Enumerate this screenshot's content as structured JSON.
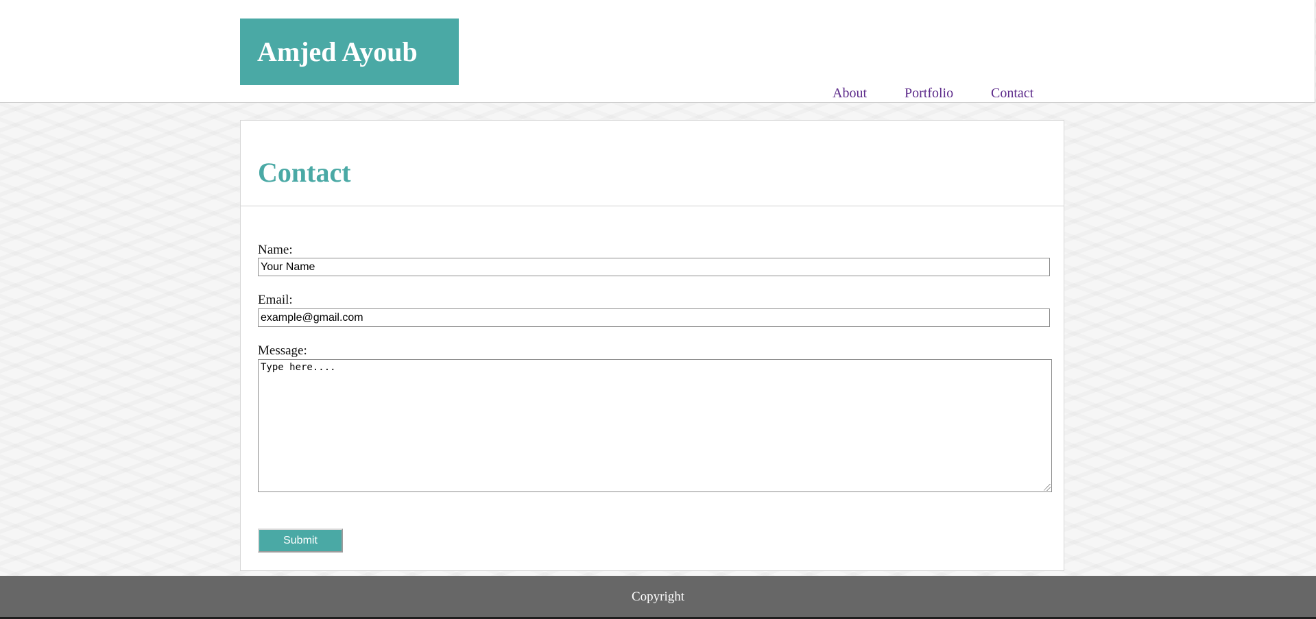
{
  "header": {
    "brand": "Amjed Ayoub",
    "nav": [
      {
        "label": "About"
      },
      {
        "label": "Portfolio"
      },
      {
        "label": "Contact"
      }
    ]
  },
  "main": {
    "title": "Contact",
    "form": {
      "name_label": "Name:",
      "name_value": "Your Name",
      "email_label": "Email:",
      "email_value": "example@gmail.com",
      "message_label": "Message:",
      "message_value": "Type here....",
      "submit_label": "Submit"
    }
  },
  "footer": {
    "text": "Copyright"
  },
  "colors": {
    "accent": "#4aa9a5",
    "nav_link": "#5c2a8a",
    "footer_bg": "#676767"
  }
}
